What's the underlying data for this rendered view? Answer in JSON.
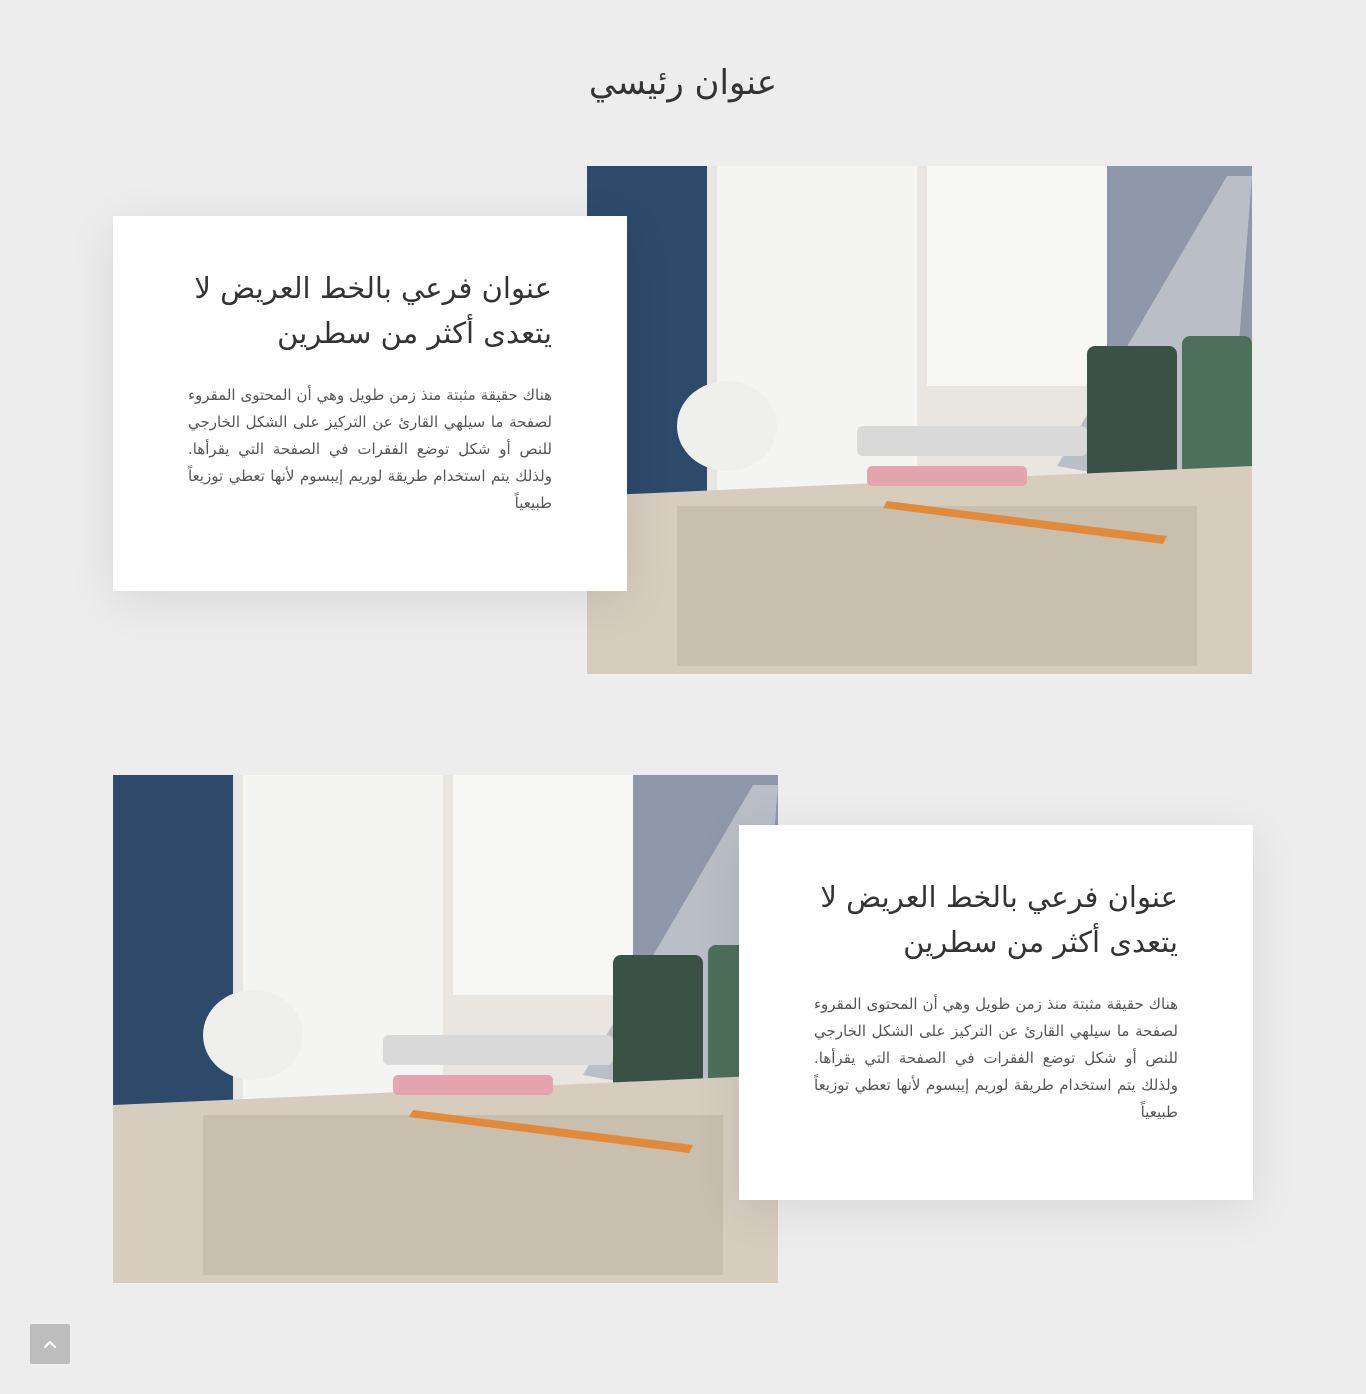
{
  "page": {
    "main_title": "عنوان رئيسي"
  },
  "sections": [
    {
      "heading": "عنوان فرعي بالخط العريض لا يتعدى أكثر من سطرين",
      "body": "هناك حقيقة مثبتة منذ زمن طويل وهي أن المحتوى المقروء لصفحة ما سيلهي القارئ عن التركيز على الشكل الخارجي للنص أو شكل توضع الفقرات في الصفحة التي يقرأها. ولذلك يتم استخدام طريقة لوريم إيبسوم لأنها تعطي توزيعاً طبيعياً"
    },
    {
      "heading": "عنوان فرعي بالخط العريض لا يتعدى أكثر من سطرين",
      "body": "هناك حقيقة مثبتة منذ زمن طويل وهي أن المحتوى المقروء لصفحة ما سيلهي القارئ عن التركيز على الشكل الخارجي للنص أو شكل توضع الفقرات في الصفحة التي يقرأها. ولذلك يتم استخدام طريقة لوريم إيبسوم لأنها تعطي توزيعاً طبيعياً"
    }
  ],
  "icons": {
    "scroll_top": "chevron-up-icon"
  },
  "colors": {
    "background": "#ededed",
    "card": "#ffffff",
    "scroll_button": "#bdbdbd"
  }
}
